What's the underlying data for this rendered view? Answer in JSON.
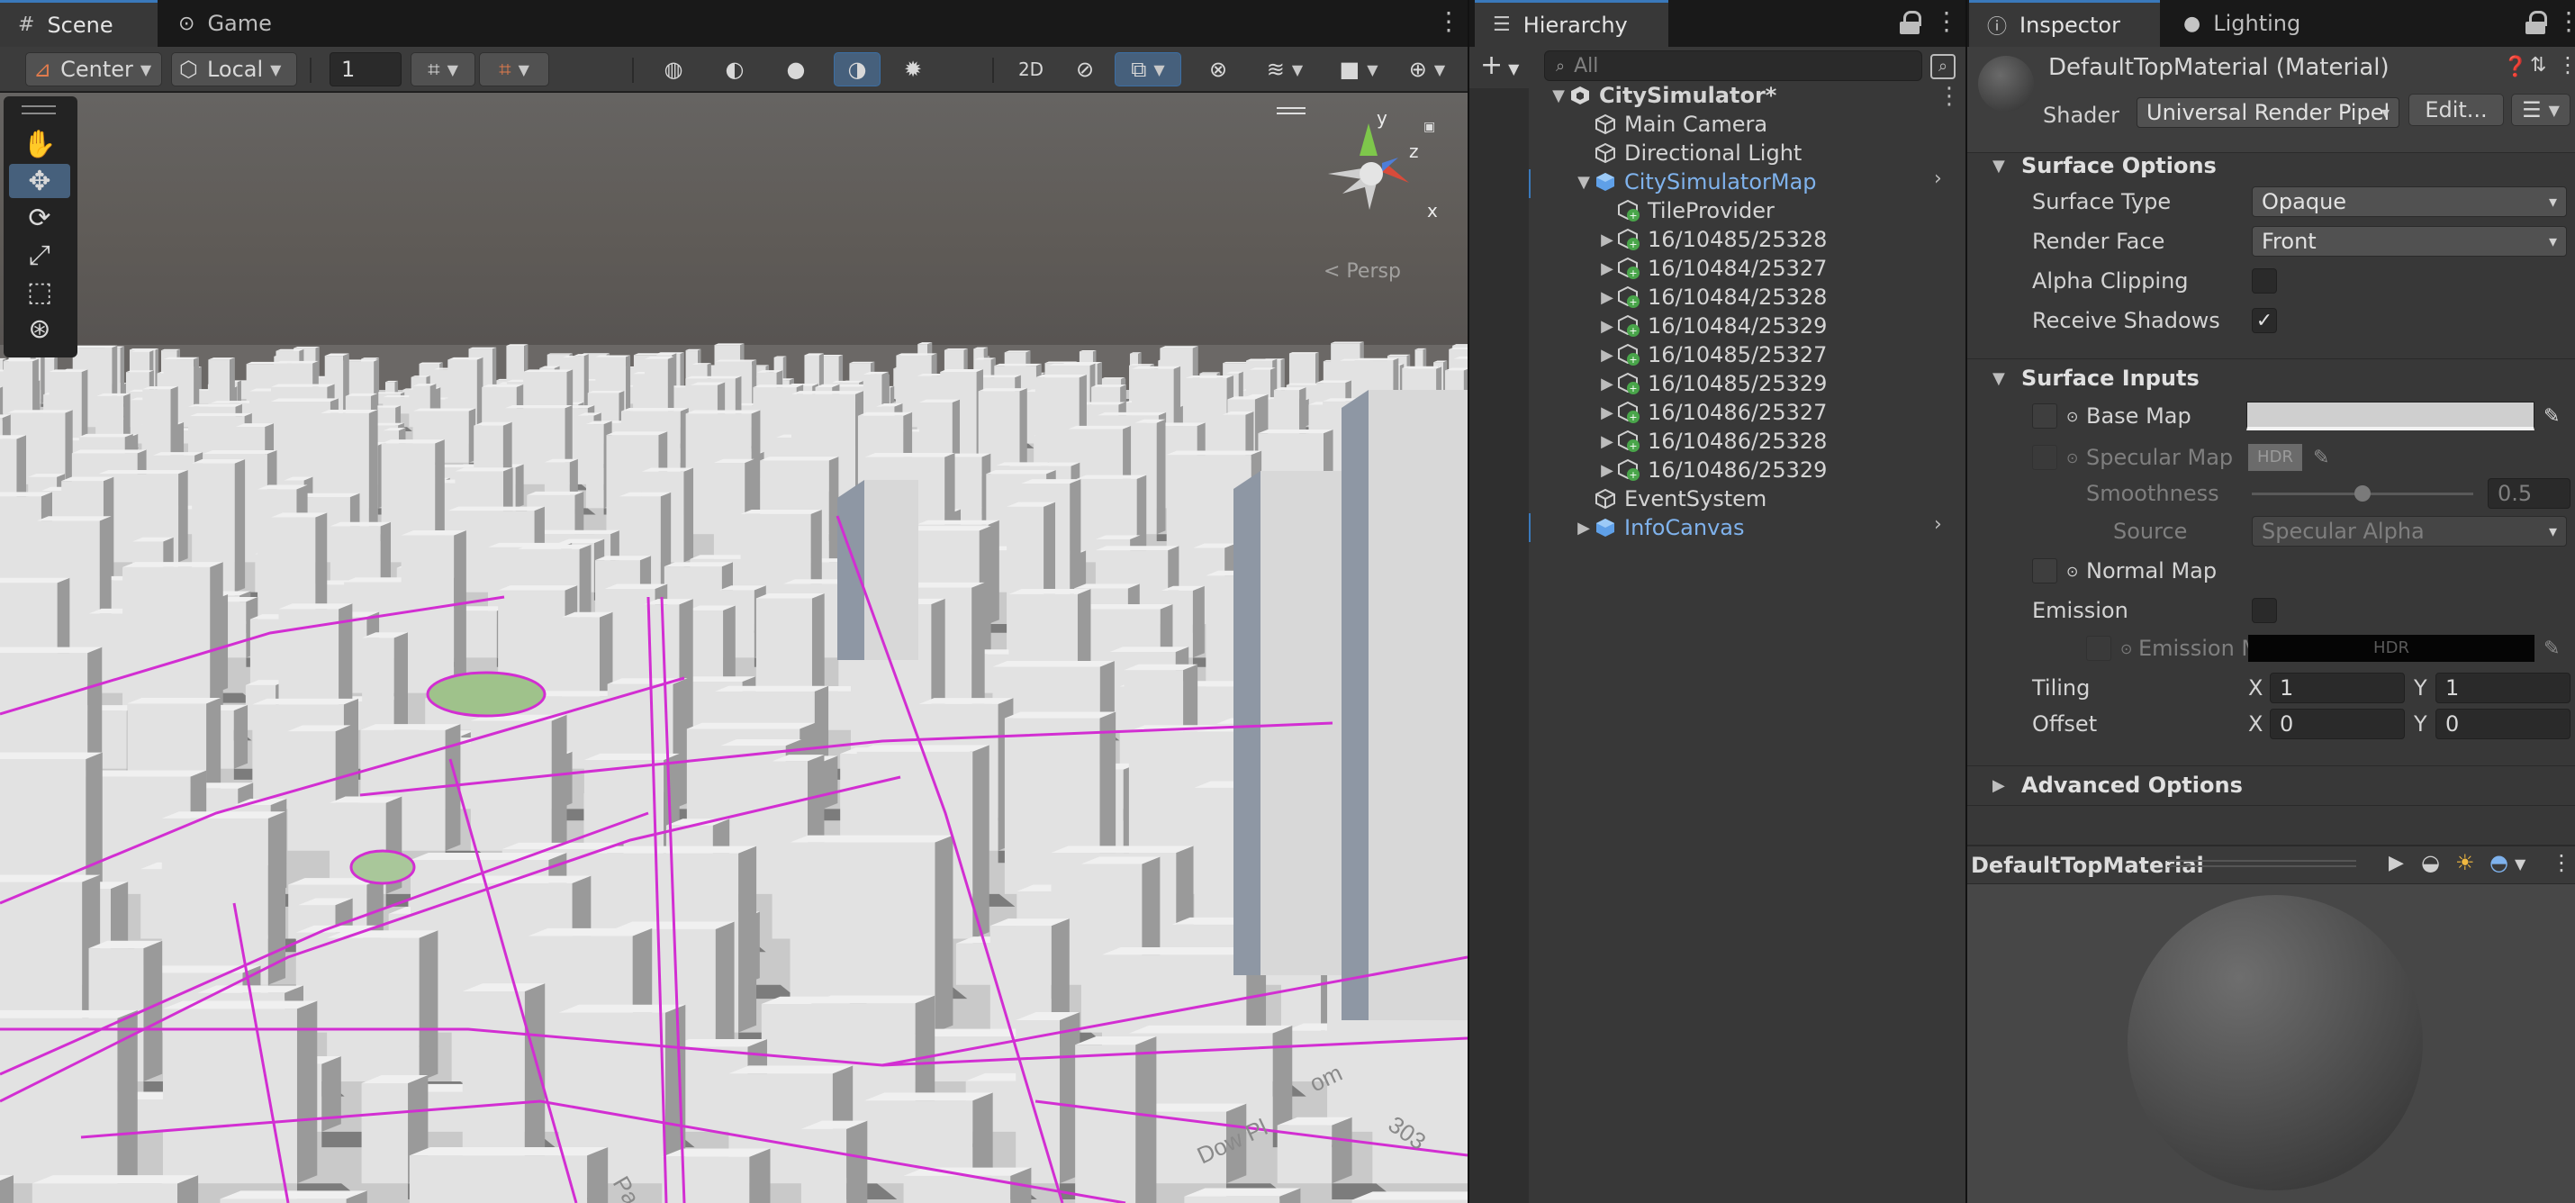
{
  "scene_panel": {
    "tabs": [
      {
        "label": "Scene",
        "icon": "hash-grid-icon"
      },
      {
        "label": "Game",
        "icon": "gamepad-icon"
      }
    ],
    "toolbar": {
      "pivot": "Center",
      "space": "Local",
      "grid_value": "1"
    },
    "gizmo": {
      "axis_x": "x",
      "axis_y": "y",
      "axis_z": "z",
      "projection": "< Persp"
    },
    "map_labels": [
      "Dow Pl",
      "303",
      "om",
      "Pa"
    ]
  },
  "hierarchy": {
    "tab": "Hierarchy",
    "search_placeholder": "All",
    "items": [
      {
        "label": "CitySimulator*",
        "depth": 0,
        "expanded": true,
        "type": "scene"
      },
      {
        "label": "Main Camera",
        "depth": 1,
        "type": "object"
      },
      {
        "label": "Directional Light",
        "depth": 1,
        "type": "object"
      },
      {
        "label": "CitySimulatorMap",
        "depth": 1,
        "expanded": true,
        "type": "prefab"
      },
      {
        "label": "TileProvider",
        "depth": 2,
        "type": "added"
      },
      {
        "label": "16/10485/25328",
        "depth": 2,
        "collapsed": true,
        "type": "added"
      },
      {
        "label": "16/10484/25327",
        "depth": 2,
        "collapsed": true,
        "type": "added"
      },
      {
        "label": "16/10484/25328",
        "depth": 2,
        "collapsed": true,
        "type": "added"
      },
      {
        "label": "16/10484/25329",
        "depth": 2,
        "collapsed": true,
        "type": "added"
      },
      {
        "label": "16/10485/25327",
        "depth": 2,
        "collapsed": true,
        "type": "added"
      },
      {
        "label": "16/10485/25329",
        "depth": 2,
        "collapsed": true,
        "type": "added"
      },
      {
        "label": "16/10486/25327",
        "depth": 2,
        "collapsed": true,
        "type": "added"
      },
      {
        "label": "16/10486/25328",
        "depth": 2,
        "collapsed": true,
        "type": "added"
      },
      {
        "label": "16/10486/25329",
        "depth": 2,
        "collapsed": true,
        "type": "added"
      },
      {
        "label": "EventSystem",
        "depth": 1,
        "type": "object"
      },
      {
        "label": "InfoCanvas",
        "depth": 1,
        "collapsed": true,
        "type": "prefab"
      }
    ]
  },
  "inspector": {
    "tabs": [
      {
        "label": "Inspector",
        "icon": "info-icon"
      },
      {
        "label": "Lighting",
        "icon": "bulb-icon"
      }
    ],
    "material_name": "DefaultTopMaterial (Material)",
    "shader_label": "Shader",
    "shader_value": "Universal Render Pipel",
    "edit_button": "Edit...",
    "surface_options": {
      "title": "Surface Options",
      "surface_type_label": "Surface Type",
      "surface_type": "Opaque",
      "render_face_label": "Render Face",
      "render_face": "Front",
      "alpha_clipping_label": "Alpha Clipping",
      "alpha_clipping": false,
      "receive_shadows_label": "Receive Shadows",
      "receive_shadows": true
    },
    "surface_inputs": {
      "title": "Surface Inputs",
      "base_map_label": "Base Map",
      "specular_map_label": "Specular Map",
      "hdr_tag": "HDR",
      "smoothness_label": "Smoothness",
      "smoothness": "0.5",
      "smoothness_fraction": 0.5,
      "source_label": "Source",
      "source": "Specular Alpha",
      "normal_map_label": "Normal Map",
      "emission_label": "Emission",
      "emission_map_label": "Emission M",
      "emission_hdr": "HDR",
      "tiling_label": "Tiling",
      "tiling_x": "1",
      "tiling_y": "1",
      "offset_label": "Offset",
      "offset_x": "0",
      "offset_y": "0",
      "x_label": "X",
      "y_label": "Y"
    },
    "advanced_options": "Advanced Options",
    "preview_title": "DefaultTopMaterial"
  },
  "colors": {
    "accent": "#3a79bb",
    "prefab_blue": "#7fb2ec",
    "road_magenta": "#d22ed2",
    "panel_bg": "#383838"
  }
}
